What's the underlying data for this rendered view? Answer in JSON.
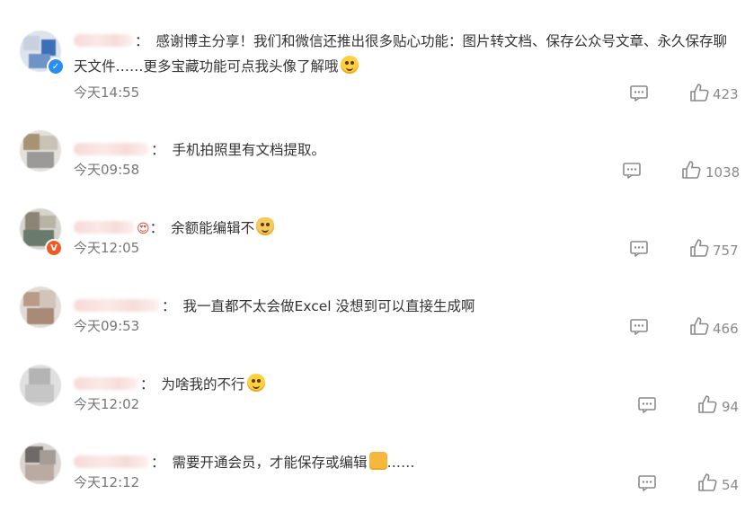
{
  "comments": [
    {
      "text_line1": "感谢博主分享！我们和微信还推出很多贴心功能：图片转文档、保存公众号文章、永久保存聊",
      "text_line2": "天文件……更多宝藏功能可点我头像了解哦",
      "time": "今天14:55",
      "likes": "423",
      "badge": "verified-blue",
      "emoji": "smiley-emoji"
    },
    {
      "text_line1": "手机拍照里有文档提取。",
      "time": "今天09:58",
      "likes": "1038"
    },
    {
      "text_line1": "余额能编辑不",
      "time": "今天12:05",
      "likes": "757",
      "badge": "vip-orange",
      "emoji": "dog-emoji"
    },
    {
      "text_line1": "我一直都不太会做Excel 没想到可以直接生成啊",
      "time": "今天09:53",
      "likes": "466"
    },
    {
      "text_line1": "为啥我的不行",
      "time": "今天12:02",
      "likes": "94",
      "emoji": "sweat-emoji"
    },
    {
      "text_line1": "需要开通会员，才能保存或编辑",
      "text_suffix": "……",
      "time": "今天12:12",
      "likes": "54",
      "emoji": "writing-hand-emoji"
    }
  ],
  "colors": {
    "text": "#333333",
    "meta": "#777777",
    "icon": "#8a8a8a",
    "verified_badge": "#2a8ef0",
    "vip_badge": "#f05a24"
  }
}
